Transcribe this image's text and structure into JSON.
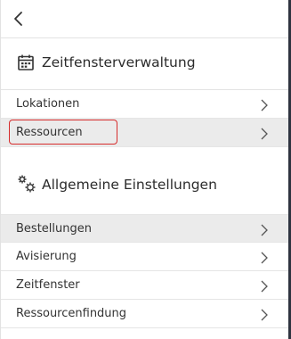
{
  "header": {
    "back_icon": "chevron-left-icon"
  },
  "sections": [
    {
      "title": "Zeitfensterverwaltung",
      "icon": "calendar-icon",
      "items": [
        {
          "label": "Lokationen"
        },
        {
          "label": "Ressourcen"
        }
      ]
    },
    {
      "title": "Allgemeine Einstellungen",
      "icon": "gears-icon",
      "items": [
        {
          "label": "Bestellungen"
        },
        {
          "label": "Avisierung"
        },
        {
          "label": "Zeitfenster"
        },
        {
          "label": "Ressourcenfindung"
        }
      ]
    }
  ],
  "colors": {
    "highlight_row": "#ebebeb",
    "annotation_box": "#d62c2c",
    "divider": "#e5e5e5"
  }
}
